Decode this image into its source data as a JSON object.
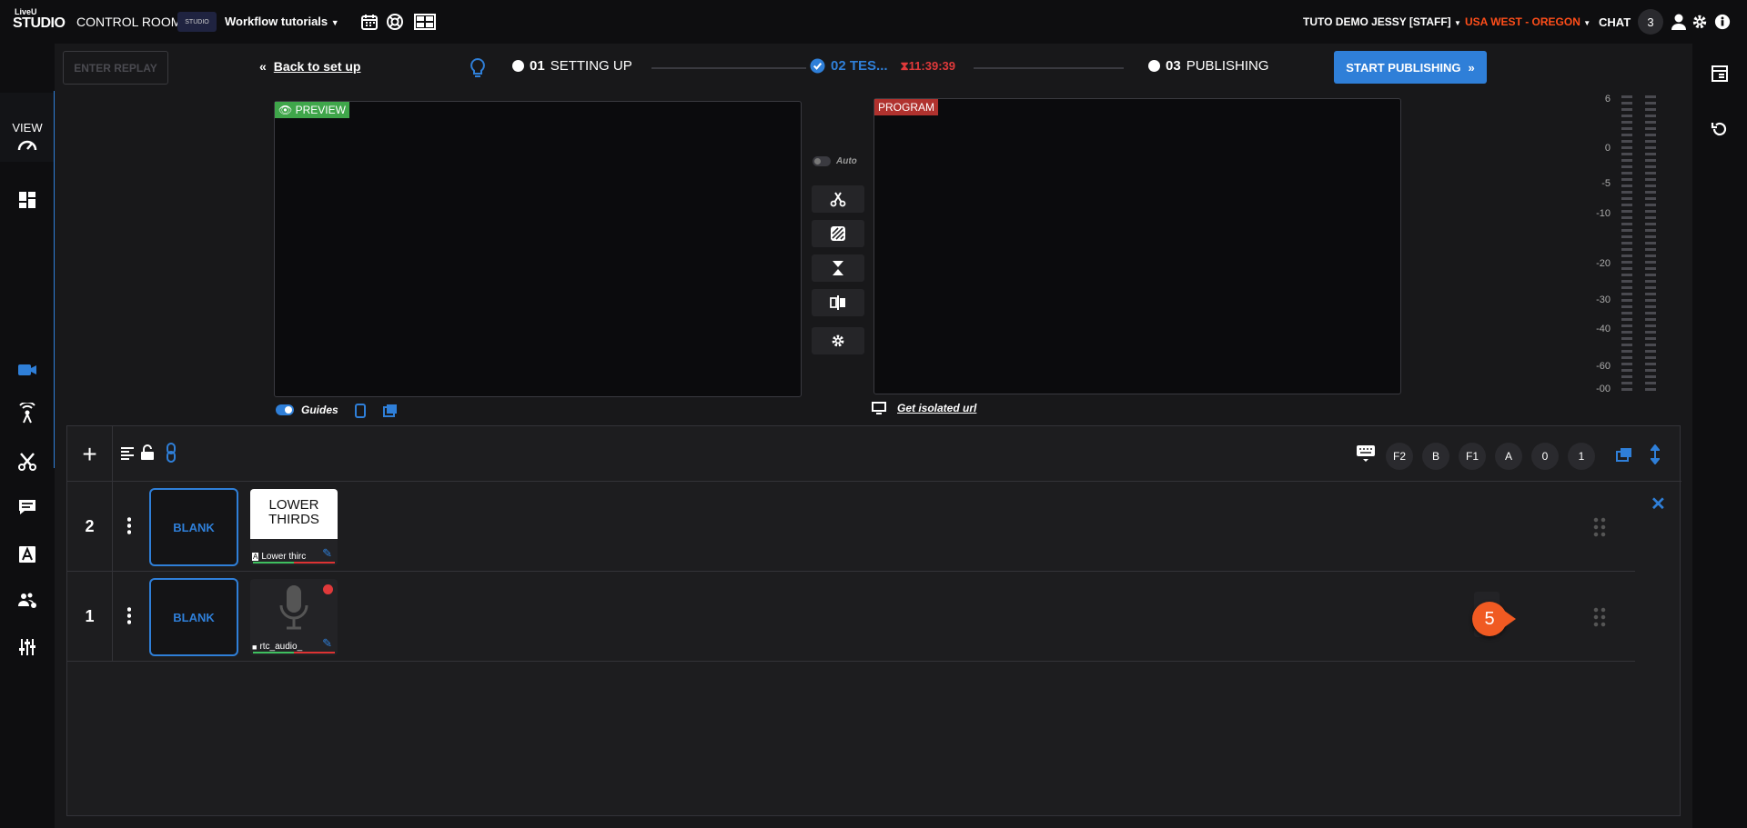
{
  "topbar": {
    "logo_top": "LiveU",
    "logo_bottom": "STUDIO",
    "control_rooms": "CONTROL ROOMS",
    "thumb_text": "STUDIO",
    "workflow": "Workflow tutorials",
    "user": "TUTO DEMO JESSY [STAFF]",
    "region": "USA WEST - OREGON",
    "chat": "CHAT",
    "chat_count": "3"
  },
  "left_rail": {
    "view": "VIEW"
  },
  "header": {
    "replay": "ENTER REPLAY",
    "back": "Back to set up",
    "step1_num": "01",
    "step1": "SETTING UP",
    "step2": "02 TES...",
    "timer": "11:39:39",
    "step3_num": "03",
    "step3": "PUBLISHING",
    "start": "START PUBLISHING"
  },
  "preview": {
    "tag": "PREVIEW",
    "guides": "Guides"
  },
  "program": {
    "tag": "PROGRAM",
    "isolated": "Get isolated url"
  },
  "controls": {
    "auto": "Auto"
  },
  "meter": {
    "labels": [
      "6",
      "0",
      "-5",
      "-10",
      "-20",
      "-30",
      "-40",
      "-60",
      "-00"
    ]
  },
  "rundown": {
    "shortcuts": [
      "F2",
      "B",
      "F1",
      "A",
      "0",
      "1"
    ],
    "rows": [
      {
        "num": "2",
        "blank": "BLANK",
        "card_title_1": "LOWER",
        "card_title_2": "THIRDS",
        "card_label": "Lower thirc"
      },
      {
        "num": "1",
        "blank": "BLANK",
        "card_label": "rtc_audio_"
      }
    ],
    "callout": "5"
  },
  "colors": {
    "accent": "#2f7fd8",
    "preview": "#3fa64a",
    "program": "#b0322e",
    "region": "#ff4e1a"
  }
}
